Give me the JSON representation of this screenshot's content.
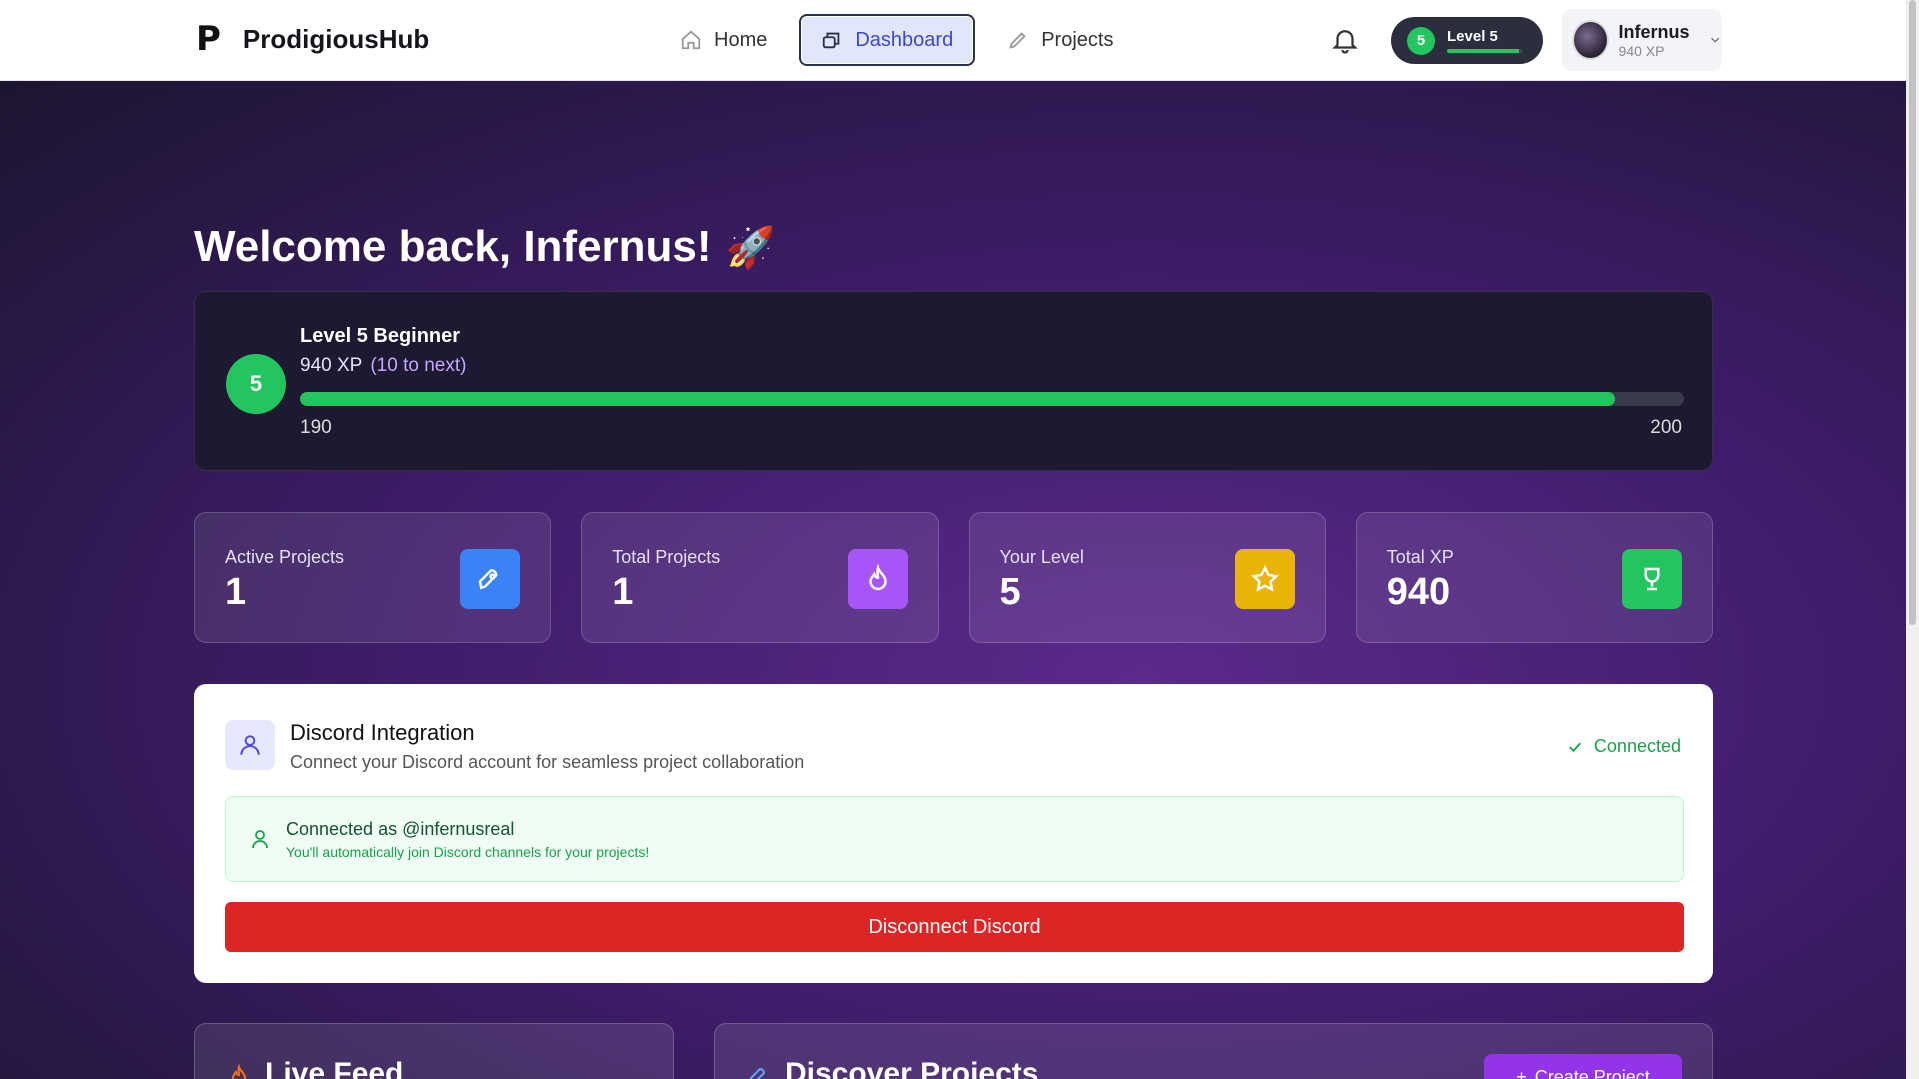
{
  "brand": {
    "logo": "P",
    "name": "ProdigiousHub"
  },
  "nav": {
    "home": "Home",
    "dashboard": "Dashboard",
    "projects": "Projects"
  },
  "header": {
    "level_label": "Level 5",
    "level_number": "5",
    "level_progress_fraction": 0.95,
    "user_name": "Infernus",
    "user_xp": "940 XP"
  },
  "welcome": {
    "text": "Welcome back, Infernus!",
    "emoji": "🚀"
  },
  "level_card": {
    "badge": "5",
    "title": "Level 5 Beginner",
    "xp": "940 XP",
    "to_next": "(10 to next)",
    "min": "190",
    "max": "200",
    "progress_fraction": 0.95
  },
  "stats": [
    {
      "label": "Active Projects",
      "value": "1",
      "icon": "rocket-icon",
      "color": "#3b82f6"
    },
    {
      "label": "Total Projects",
      "value": "1",
      "icon": "flame-icon",
      "color": "#a855f7"
    },
    {
      "label": "Your Level",
      "value": "5",
      "icon": "star-icon",
      "color": "#eab308"
    },
    {
      "label": "Total XP",
      "value": "940",
      "icon": "trophy-icon",
      "color": "#22c55e"
    }
  ],
  "discord": {
    "title": "Discord Integration",
    "subtitle": "Connect your Discord account for seamless project collaboration",
    "status": "Connected",
    "connected_as": "Connected as @infernusreal",
    "connected_note": "You'll automatically join Discord channels for your projects!",
    "disconnect_label": "Disconnect Discord"
  },
  "bottom": {
    "feed_title": "Live Feed",
    "discover_title": "Discover Projects",
    "create_label": "Create Project"
  },
  "colors": {
    "accent_green": "#22c55e",
    "danger": "#dc2626",
    "active_nav": "#3a49c9"
  }
}
